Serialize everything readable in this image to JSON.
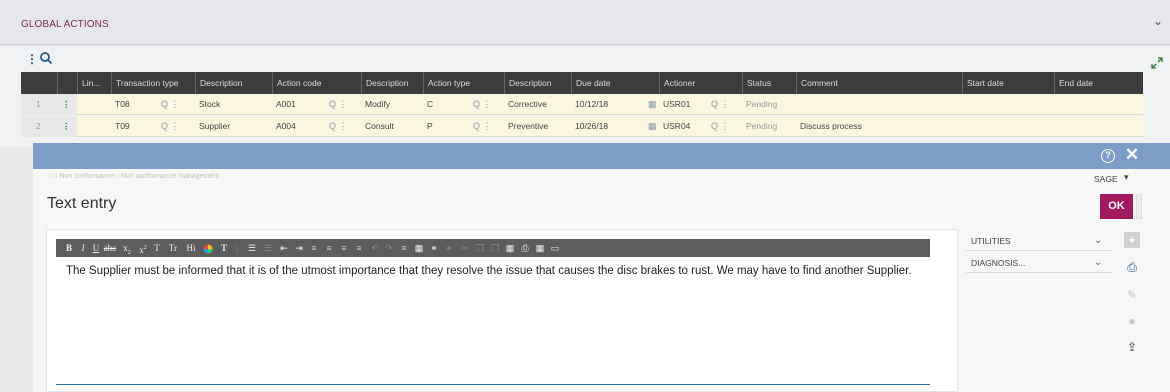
{
  "section": {
    "title": "GLOBAL ACTIONS"
  },
  "grid": {
    "headers": [
      "Lin...",
      "Transaction type",
      "Description",
      "Action code",
      "Description",
      "Action type",
      "Description",
      "Due date",
      "Actioner",
      "Status",
      "Comment",
      "Start date",
      "End date"
    ],
    "rows": [
      {
        "num": "1",
        "transaction_type": "T08",
        "tt_description": "Stock",
        "action_code": "A001",
        "ac_description": "Modify",
        "action_type": "C",
        "at_description": "Corrective",
        "due_date": "10/12/18",
        "actioner": "USR01",
        "status": "Pending",
        "comment": ""
      },
      {
        "num": "2",
        "transaction_type": "T09",
        "tt_description": "Supplier",
        "action_code": "A004",
        "ac_description": "Consult",
        "action_type": "P",
        "at_description": "Preventive",
        "due_date": "10/26/18",
        "actioner": "USR04",
        "status": "Pending",
        "comment": "Discuss process"
      }
    ]
  },
  "modal": {
    "breadcrumb": [
      "Non conformance",
      "Non conformance management"
    ],
    "company": "SAGE",
    "title": "Text entry",
    "ok_label": "OK",
    "editor_text": "The Supplier must be informed that it is of the utmost importance that they resolve the issue that causes the disc brakes to rust. We may have to find another Supplier.",
    "side_sections": [
      "UTILITIES",
      "DIAGNOSIS..."
    ]
  },
  "toolbar": {
    "bold": "B",
    "italic": "I",
    "underline": "U",
    "strike": "abc",
    "subscript": "x",
    "sub_mark": "2",
    "superscript": "x",
    "sup_mark": "2",
    "text_t": "T",
    "tt": "Tr",
    "hi": "Hi",
    "font_t": "T"
  },
  "colors": {
    "accent": "#a3195d",
    "modal_bar": "#7d9ec8",
    "grid_header": "#3c3c3c",
    "row_bg": "#fbf6de",
    "editor_line": "#2f6aa8"
  }
}
